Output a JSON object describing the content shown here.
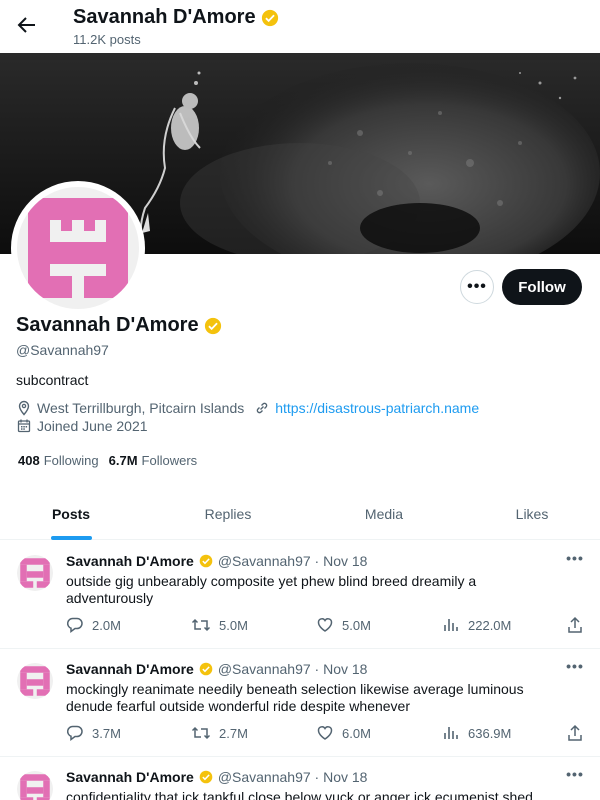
{
  "header": {
    "title": "Savannah D'Amore",
    "post_count": "11.2K posts"
  },
  "profile": {
    "name": "Savannah D'Amore",
    "handle": "@Savannah97",
    "bio": "subcontract",
    "location": "West Terrillburgh, Pitcairn Islands",
    "website": "https://disastrous-patriarch.name",
    "joined": "Joined June 2021",
    "following_count": "408",
    "following_label": "Following",
    "followers_count": "6.7M",
    "followers_label": "Followers",
    "follow_label": "Follow",
    "more_label": "•••",
    "verified_color": "#f4c20d",
    "avatar_color": "#e26fb4"
  },
  "tabs": [
    {
      "label": "Posts",
      "active": true
    },
    {
      "label": "Replies",
      "active": false
    },
    {
      "label": "Media",
      "active": false
    },
    {
      "label": "Likes",
      "active": false
    }
  ],
  "posts": [
    {
      "name": "Savannah D'Amore",
      "meta": "@Savannah97 · Nov 18",
      "text": "outside gig unbearably composite yet phew blind breed dreamily a adventurously",
      "replies": "2.0M",
      "reposts": "5.0M",
      "likes": "5.0M",
      "views": "222.0M"
    },
    {
      "name": "Savannah D'Amore",
      "meta": "@Savannah97 · Nov 18",
      "text": "mockingly reanimate needily beneath selection likewise average luminous denude fearful outside wonderful ride despite whenever",
      "replies": "3.7M",
      "reposts": "2.7M",
      "likes": "6.0M",
      "views": "636.9M"
    },
    {
      "name": "Savannah D'Amore",
      "meta": "@Savannah97 · Nov 18",
      "text": "confidentiality that ick tankful close below yuck or anger ick ecumenist shed"
    }
  ],
  "post_more_label": "•••",
  "icons": {
    "back": "back-arrow-icon",
    "verified": "verified-badge-icon",
    "location": "location-pin-icon",
    "link": "link-icon",
    "calendar": "calendar-icon",
    "reply": "reply-icon",
    "repost": "repost-icon",
    "like": "heart-icon",
    "views": "views-icon",
    "share": "share-icon"
  }
}
